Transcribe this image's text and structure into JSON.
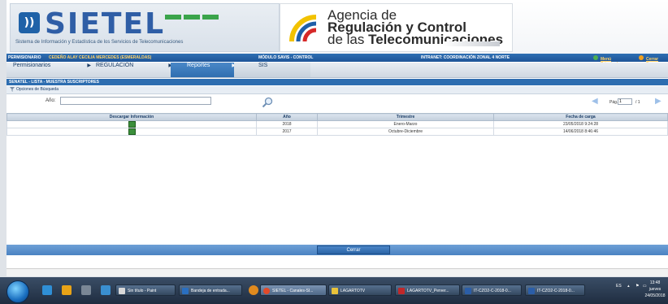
{
  "header": {
    "sietel_logo": "SIETEL",
    "sietel_subtitle": "Sistema de Información y Estadística de los Servicios de Telecomunicaciones",
    "agency_line1": "Agencia de",
    "agency_line2": "Regulación y Control",
    "agency_line3a": "de las ",
    "agency_line3b": "Telecomunicaciones"
  },
  "infobar": {
    "user_label": "PERMISIONARIO",
    "user_name": "CEDEÑO ALAY CECILIA MERCEDES (ESMERALDAS)",
    "module": "MÓDULO SAVIS - CONTROL",
    "intranet": "INTRANET: COORDINACIÓN ZONAL 4 NORTE",
    "home_link": "Menú Principal",
    "logout_link": "Cerrar Ses"
  },
  "menu": {
    "items": [
      "Permisionarios",
      "REGULACIÓN",
      "Reportes",
      "SIS"
    ],
    "arrow": "▶"
  },
  "section": {
    "title": "SENATEL - LISTA - MUESTRA SUSCRIPTORES",
    "search_options": "Opciones de Búsqueda"
  },
  "filter": {
    "year_label": "Año:",
    "year_value": ""
  },
  "pager": {
    "label": "Pág.",
    "page_value": "1",
    "total": "/ 1",
    "prev": "◀",
    "next": "▶"
  },
  "table": {
    "headers": [
      "Descargar Información",
      "Año",
      "Trimestre",
      "Fecha de carga"
    ],
    "rows": [
      {
        "year": "2018",
        "quarter": "Enero-Marzo",
        "date": "23/05/2018 9:24:28"
      },
      {
        "year": "2017",
        "quarter": "Octubre-Diciembre",
        "date": "14/06/2018 8:46:46"
      }
    ]
  },
  "bottom": {
    "close_label": "Cerrar"
  },
  "taskbar": {
    "tasks": [
      "Sin título - Paint",
      "Bandeja de entrada...",
      "SIETEL - Canales-SI...",
      "LAGARTOTV",
      "LAGARTOTV_Perver...",
      "IT-CZO2-C-2018-0...",
      "IT-CZO2-C-2018-0..."
    ],
    "lang": "ES",
    "time": "13:48",
    "day": "jueves",
    "date": "24/05/2018"
  },
  "colors": {
    "brand_blue": "#2d6db0",
    "accent_green": "#3aa44b"
  }
}
